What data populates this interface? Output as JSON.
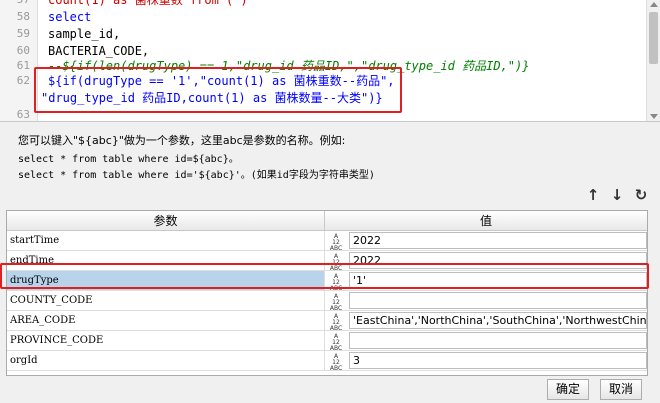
{
  "editor": {
    "lines": [
      {
        "num": "57",
        "text": "count(1) as 菌株重数 from ( )"
      },
      {
        "num": "58",
        "text": "select"
      },
      {
        "num": "59",
        "text": "sample_id,"
      },
      {
        "num": "60",
        "text": "BACTERIA_CODE,"
      },
      {
        "num": "61",
        "text": "--${if(len(drugType) == 1,\"drug_id 药品ID,\",\"drug_type_id 药品ID,\")}"
      },
      {
        "num": "62",
        "text": "${if(drugType == '1',\"count(1) as 菌株重数--药品\","
      },
      {
        "num": "",
        "text": "\"drug_type_id 药品ID,count(1) as 菌株数量--大类\")}"
      },
      {
        "num": "63",
        "text": ""
      }
    ]
  },
  "help": {
    "line1": "您可以键入\"${abc}\"做为一个参数，这里abc是参数的名称。例如:",
    "line2": "select * from table where id=${abc}。",
    "line3": "select * from table where id='${abc}'。(如果id字段为字符串类型)"
  },
  "toolbar": {
    "up_icon": "↑",
    "down_icon": "↓",
    "refresh_icon": "↻"
  },
  "table": {
    "col_param": "参数",
    "col_value": "值",
    "type_label_top": "A",
    "type_label_mid": "12",
    "type_label_bot": "ABC",
    "rows": [
      {
        "name": "startTime",
        "value": "2022"
      },
      {
        "name": "endTime",
        "value": "2022"
      },
      {
        "name": "drugType",
        "value": "'1'"
      },
      {
        "name": "COUNTY_CODE",
        "value": ""
      },
      {
        "name": "AREA_CODE",
        "value": "'EastChina','NorthChina','SouthChina','NorthwestChina'"
      },
      {
        "name": "PROVINCE_CODE",
        "value": ""
      },
      {
        "name": "orgId",
        "value": "3"
      }
    ]
  },
  "buttons": {
    "ok": "确定",
    "cancel": "取消"
  }
}
